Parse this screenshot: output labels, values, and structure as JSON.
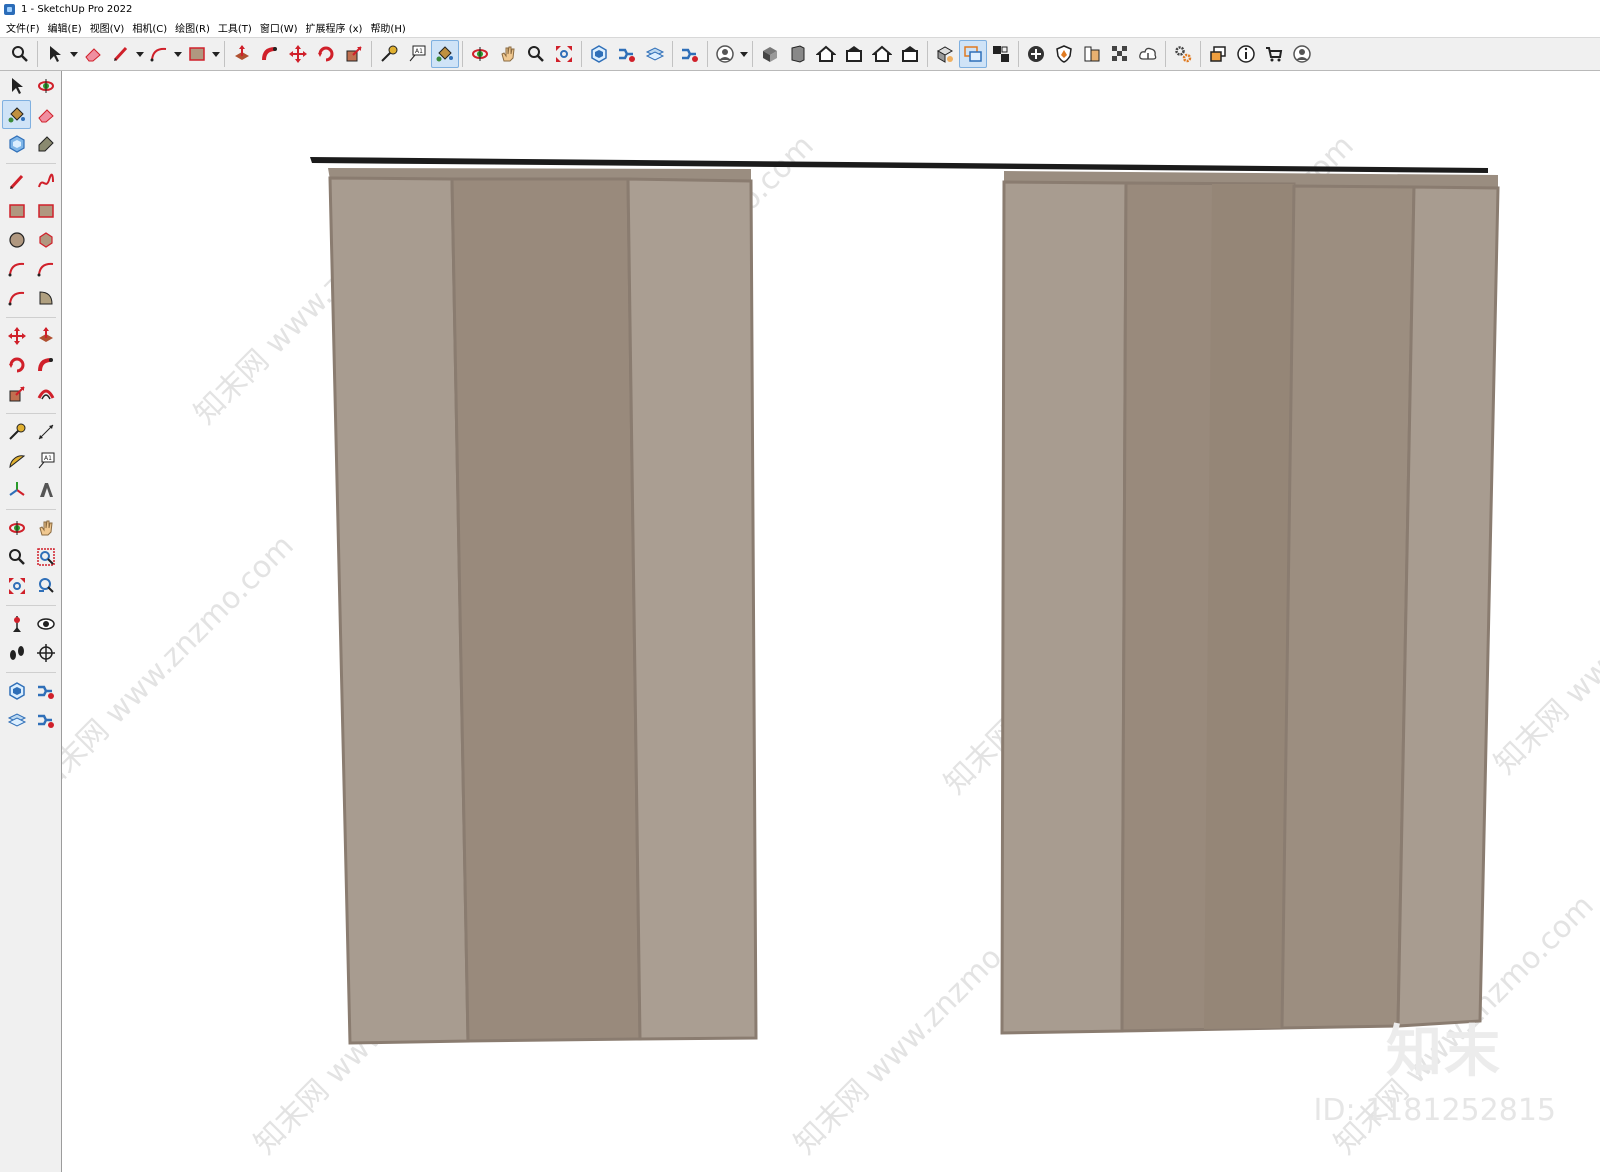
{
  "window": {
    "title": "1 - SketchUp Pro 2022"
  },
  "menu": [
    "文件(F)",
    "编辑(E)",
    "视图(V)",
    "相机(C)",
    "绘图(R)",
    "工具(T)",
    "窗口(W)",
    "扩展程序 (x)",
    "帮助(H)"
  ],
  "colors": {
    "panel_light": "#a89c90",
    "panel_dark": "#998a7c",
    "panel_edge": "#8a7c70",
    "rail": "#1b1b1b",
    "header": "#9a8d80",
    "toolbar_bg": "#f0f0f0",
    "active_tool": "#cfe3f7"
  },
  "top_toolbar": {
    "groups": [
      [
        "zoom-icon"
      ],
      [
        "select-icon",
        "dropdown",
        "eraser-icon",
        "pencil-icon",
        "dropdown",
        "arc-icon",
        "dropdown",
        "rectangle-icon",
        "dropdown"
      ],
      [
        "push-pull-icon",
        "follow-me-icon",
        "move-icon",
        "rotate-icon",
        "scale-icon"
      ],
      [
        "tape-measure-icon",
        "text-icon",
        "paint-bucket-icon"
      ],
      [
        "orbit-icon",
        "pan-icon",
        "zoom-icon",
        "zoom-extents-icon"
      ],
      [
        "warehouse-icon",
        "extension-warehouse-icon",
        "layout-icon"
      ],
      [
        "extension-manager-icon"
      ],
      [
        "user-icon",
        "dropdown"
      ],
      [
        "iso-view-icon",
        "front-view-icon",
        "top-view-icon",
        "right-view-icon",
        "back-view-icon",
        "left-view-icon"
      ],
      [
        "solid-tools-icon",
        "component-icon",
        "group-icon"
      ],
      [
        "add-location-icon",
        "shield-icon",
        "styles-icon",
        "texture-icon",
        "cloud-upload-icon"
      ],
      [
        "settings-icon"
      ],
      [
        "window-icon",
        "info-icon",
        "cart-icon",
        "account-icon"
      ]
    ],
    "active": [
      "paint-bucket-icon",
      "component-icon"
    ]
  },
  "left_toolbar": {
    "groups": [
      [
        "select-icon",
        "orbit-3d-icon",
        "paint-bucket-icon",
        "eraser-icon",
        "components-icon",
        "tag-icon"
      ],
      [
        "pencil-icon",
        "freehand-icon",
        "rectangle-icon",
        "rotated-rectangle-icon",
        "circle-icon",
        "polygon-icon",
        "arc-icon",
        "two-point-arc-icon",
        "three-point-arc-icon",
        "pie-icon"
      ],
      [
        "move-icon",
        "push-pull-icon",
        "rotate-icon",
        "follow-me-icon",
        "scale-icon",
        "offset-icon"
      ],
      [
        "tape-measure-icon",
        "dimension-icon",
        "protractor-icon",
        "text-icon",
        "axes-icon",
        "3d-text-icon"
      ],
      [
        "orbit-icon",
        "pan-icon",
        "zoom-icon",
        "zoom-window-icon",
        "zoom-extents-icon",
        "previous-view-icon"
      ],
      [
        "position-camera-icon",
        "look-around-icon",
        "walk-icon",
        "section-plane-icon"
      ],
      [
        "warehouse-icon",
        "extension-warehouse-icon",
        "layout-icon",
        "extension-manager-icon"
      ]
    ],
    "active": [
      "paint-bucket-icon"
    ]
  },
  "watermark": {
    "text": "知末网 www.znzmo.com",
    "logo": "知末",
    "id": "ID: 1181252815"
  }
}
